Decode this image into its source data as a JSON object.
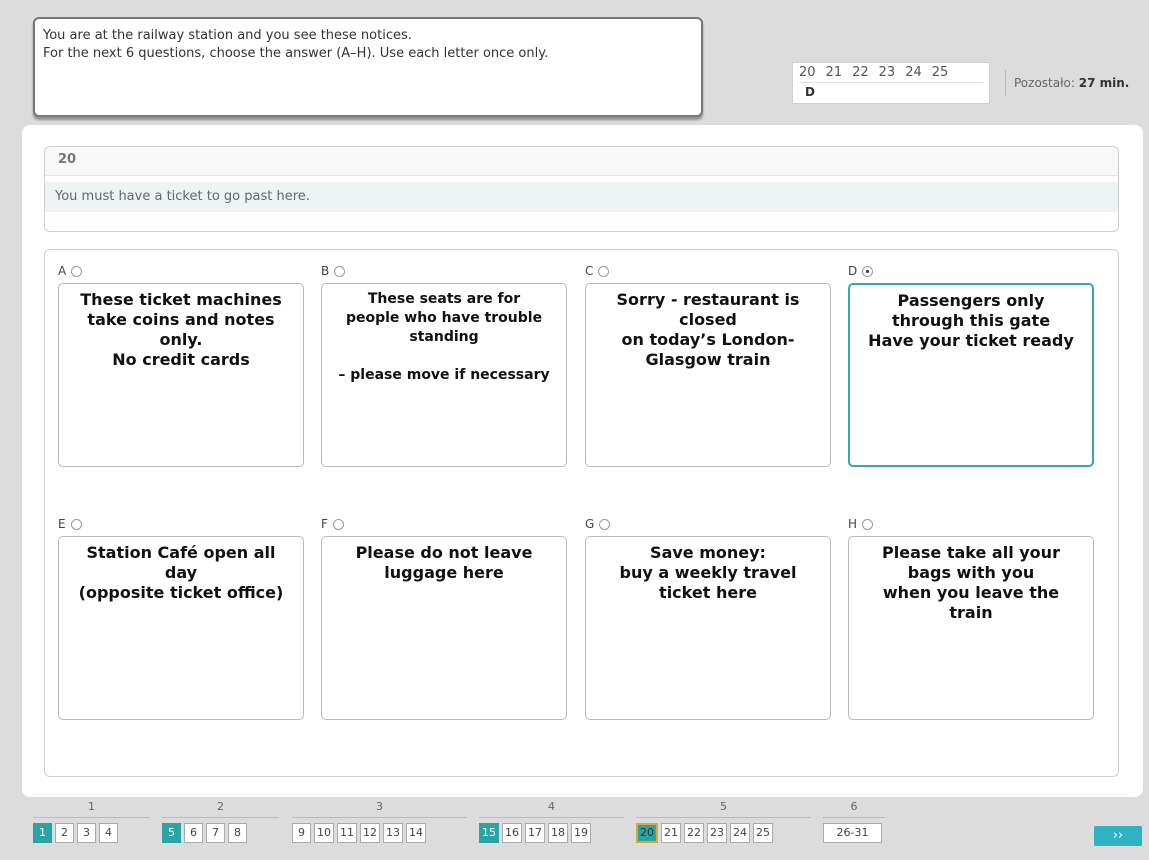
{
  "instructions": {
    "line1": "You are at the railway station and you see these notices.",
    "line2": "For the next 6 questions, choose the answer (A–H). Use each letter once only."
  },
  "question_nav": {
    "numbers": [
      "20",
      "21",
      "22",
      "23",
      "24",
      "25"
    ],
    "answer_20": "D"
  },
  "timer": {
    "label": "Pozostało:",
    "value": "27 min."
  },
  "question": {
    "number": "20",
    "prompt": "You must have a ticket to go past here."
  },
  "options": [
    {
      "letter": "A",
      "text": "These ticket machines\ntake coins and notes\nonly.\nNo credit cards",
      "selected": false
    },
    {
      "letter": "B",
      "text": "These seats are for\npeople who have trouble\nstanding\n\n– please move if necessary",
      "selected": false
    },
    {
      "letter": "C",
      "text": "Sorry - restaurant is\nclosed\non today’s London-\nGlasgow train",
      "selected": false
    },
    {
      "letter": "D",
      "text": "Passengers only\nthrough this gate\nHave your ticket ready",
      "selected": true
    },
    {
      "letter": "E",
      "text": "Station Café open all\nday\n(opposite ticket office)",
      "selected": false
    },
    {
      "letter": "F",
      "text": "Please do not leave\nluggage here",
      "selected": false
    },
    {
      "letter": "G",
      "text": "Save money:\nbuy a weekly travel\nticket here",
      "selected": false
    },
    {
      "letter": "H",
      "text": "Please take all your\nbags with you\nwhen you leave the\ntrain",
      "selected": false
    }
  ],
  "pager": {
    "groups": [
      {
        "label": "1",
        "pages": [
          "1",
          "2",
          "3",
          "4"
        ]
      },
      {
        "label": "2",
        "pages": [
          "5",
          "6",
          "7",
          "8"
        ]
      },
      {
        "label": "3",
        "pages": [
          "9",
          "10",
          "11",
          "12",
          "13",
          "14"
        ]
      },
      {
        "label": "4",
        "pages": [
          "15",
          "16",
          "17",
          "18",
          "19"
        ]
      },
      {
        "label": "5",
        "pages": [
          "20",
          "21",
          "22",
          "23",
          "24",
          "25"
        ]
      },
      {
        "label": "6",
        "pages": [
          "26-31"
        ]
      }
    ],
    "next_label": "››",
    "colors": {
      "done": "#2aa3a3",
      "current_border": "#d8a93a"
    }
  }
}
